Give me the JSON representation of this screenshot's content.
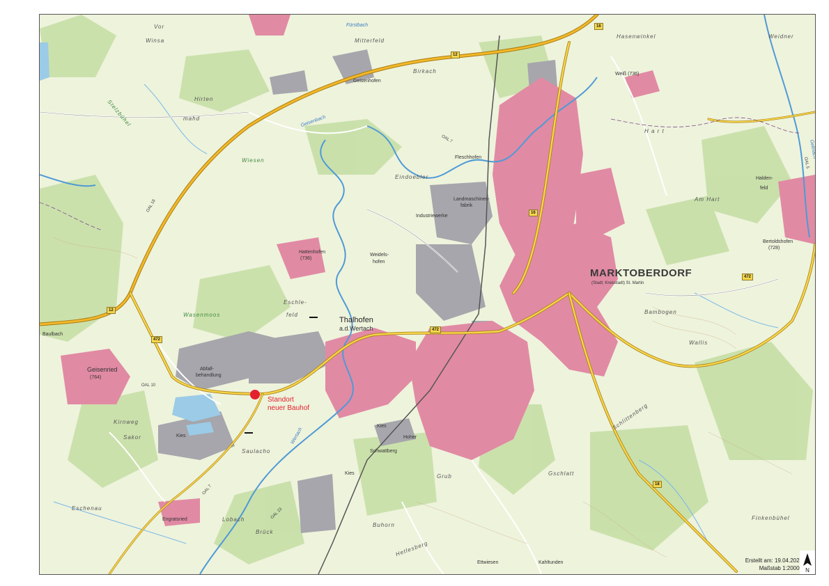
{
  "map": {
    "town_main": "MARKTOBERDORF",
    "town_main_sub": "(Stadt; Kreisstadt) St. Martin",
    "thalhofen_line1": "Thalhofen",
    "thalhofen_line2": "a.d.Wertach",
    "places": {
      "geisenried": "Geisenried",
      "geisenried_elev": "(764)",
      "hattenhofen": "Hattenhofen",
      "hattenhofen_elev": "(736)",
      "geisenhofen": "Geisenhofen",
      "birkach": "Birkach",
      "mitterfeld": "Mitterfeld",
      "hasenwinkel": "Hasenwinkel",
      "weidner": "Weidner",
      "weiss": "Weiß (736)",
      "hart": "H a r t",
      "am_hart": "Am Hart",
      "haldenfeld_1": "Halden-",
      "haldenfeld_2": "feld",
      "bertoldshofen": "Bertoldshofen",
      "bertoldshofen_elev": "(728)",
      "fleschhofen": "Fleschhofen",
      "eindoebler": "Eindoebler",
      "weidelshofen_1": "Weidels-",
      "weidelshofen_2": "hofen",
      "eschlefeld_1": "Eschle-",
      "eschlefeld_2": "feld",
      "wasenmoos": "Wasenmoos",
      "wiesen": "Wiesen",
      "stelzbuehel": "Stelzbühel",
      "hirtenmahd_1": "Hirten",
      "hirtenmahd_2": "mahd",
      "winsa": "Winsa",
      "vor": "Vor",
      "kirnweg": "Kirnweg",
      "sakor": "Sakor",
      "saulacho": "Saulacho",
      "eschenau": "Eschenau",
      "engratsried": "Engratsried",
      "lobach": "Lobach",
      "bruck": "Brück",
      "buhorn": "Buhorn",
      "grub": "Grub",
      "gschlatt": "Gschlatt",
      "bambogen": "Bambogen",
      "wallis": "Wallis",
      "schlittenberg": "Schlittenberg",
      "finkenbuehel": "Finkenbühel",
      "kahltunden": "Kahltunden",
      "ettwiesen": "Ettwiesen",
      "hetlesberg": "Hetlesberg",
      "baulbach": "Baulbach",
      "landmaschinenfabrik_1": "Landmaschinen-",
      "landmaschinenfabrik_2": "fabrik",
      "industriewerke": "Industriewerke",
      "abfall_1": "Abfall-",
      "abfall_2": "behandlung",
      "kies1": "Kies",
      "kies2": "Kies",
      "schwattberg": "Schwattberg",
      "hoher": "Hoher",
      "kies3": "Kies"
    },
    "water": {
      "wertach": "Wertach",
      "geisenbach": "Geisenbach",
      "fuernbach": "Fürstbach",
      "geltnach": "Geltnach"
    },
    "roads": {
      "b12_a": "12",
      "b12_b": "12",
      "b16_a": "16",
      "b16_b": "16",
      "b472_a": "472",
      "b472_b": "472",
      "b472_c": "472",
      "b18": "18",
      "oal10": "OAL 10",
      "oal18": "OAL 18",
      "oal7_a": "OAL 7",
      "oal7_b": "OAL 7",
      "oal23": "OAL 23",
      "oal5": "OAL 5"
    }
  },
  "marker": {
    "line1": "Standort",
    "line2": "neuer Bauhof",
    "color": "#e5202e"
  },
  "footer": {
    "created_label": "Erstellt am: 19.04.2023",
    "scale_label": "Maßstab 1:20000",
    "north_symbol": "N"
  },
  "colors": {
    "urban": "#e18aa4",
    "industrial": "#a4a4aa",
    "forest": "#c4dea6",
    "meadow": "#eef3dc",
    "water": "#9bcbe6",
    "federal_road": "#f2b829",
    "minor_road": "#ffffff"
  }
}
